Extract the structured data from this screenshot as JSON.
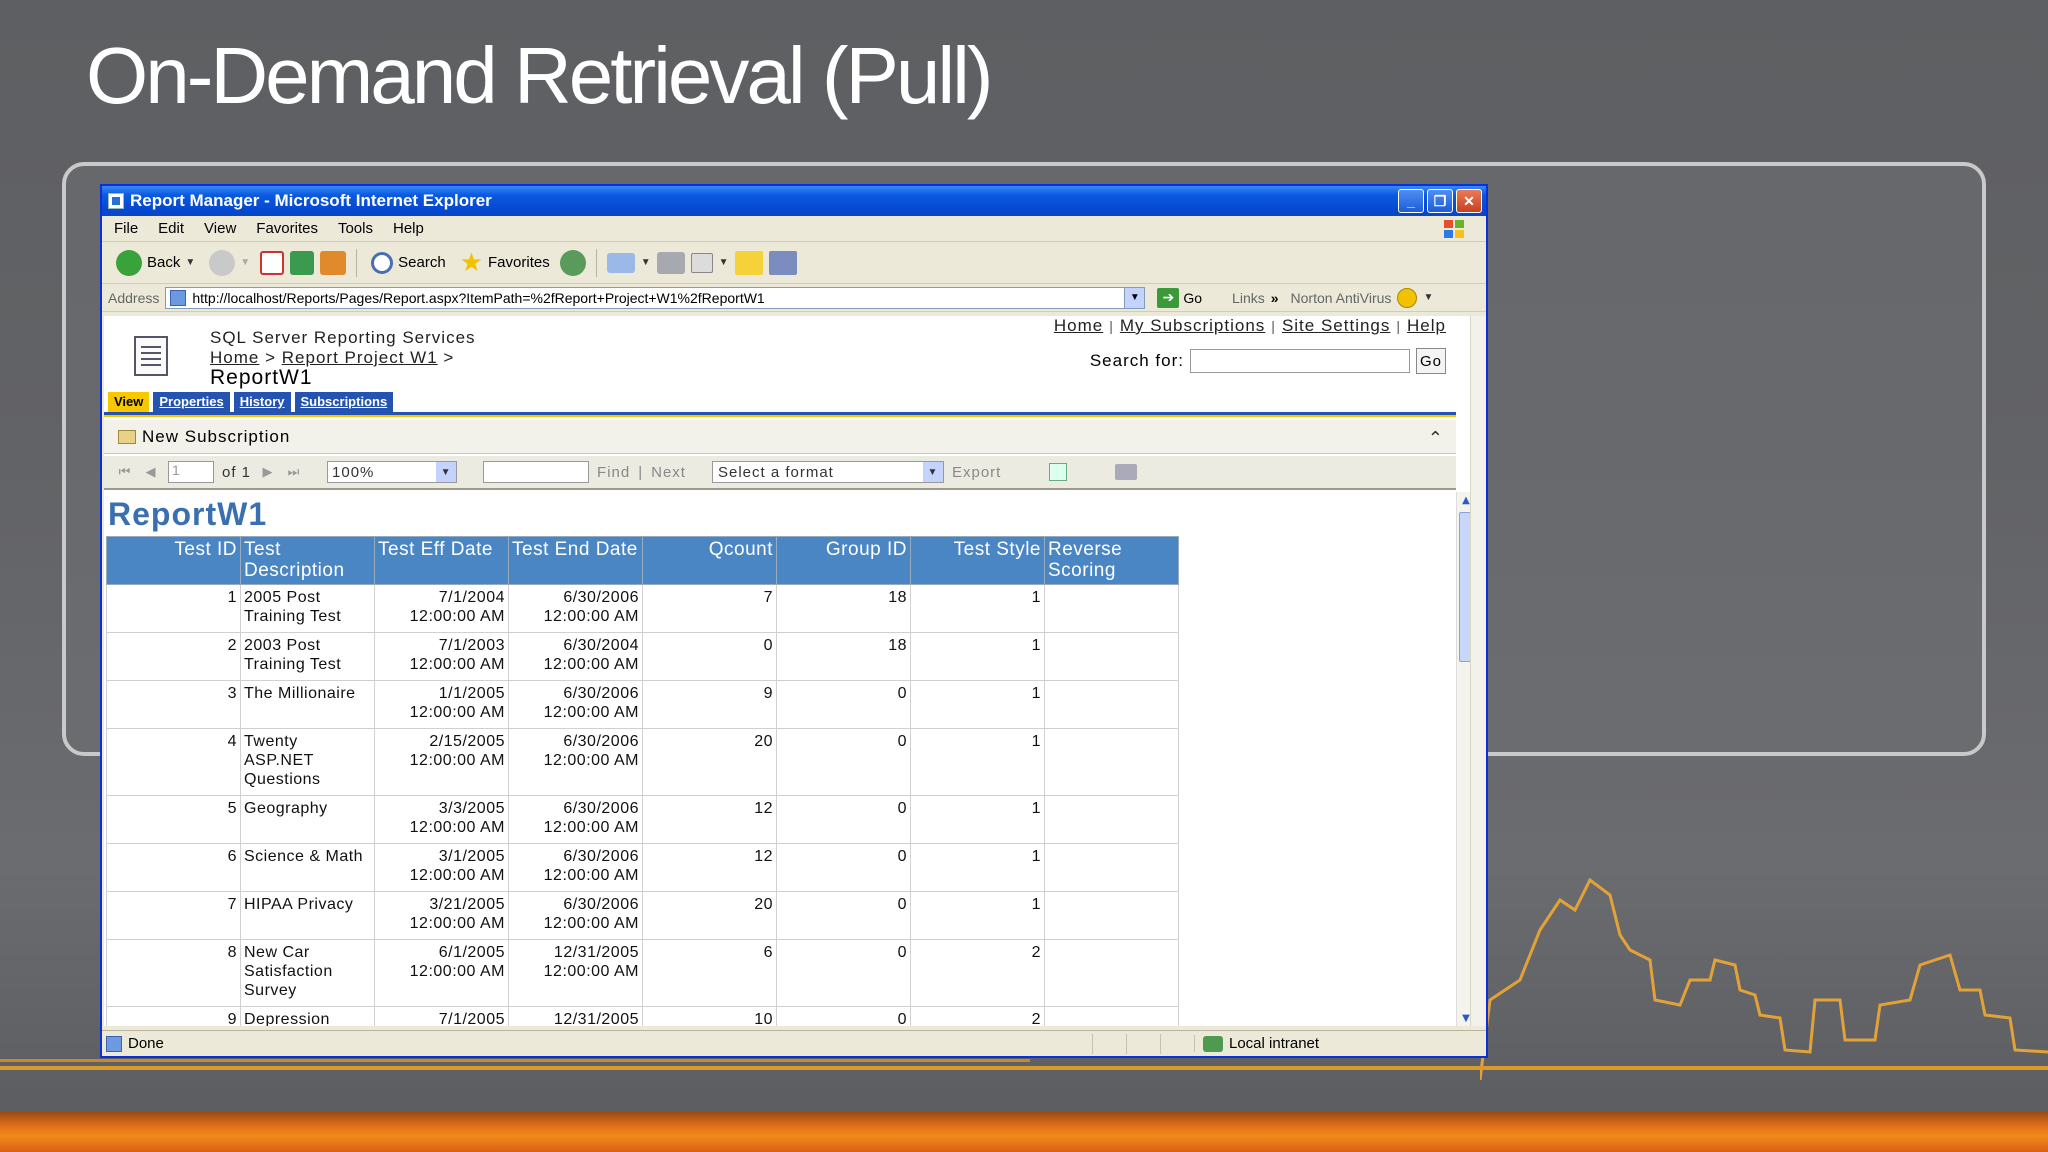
{
  "slide": {
    "title": "On-Demand Retrieval (Pull)"
  },
  "window": {
    "title": "Report Manager - Microsoft Internet Explorer"
  },
  "menu": [
    "File",
    "Edit",
    "View",
    "Favorites",
    "Tools",
    "Help"
  ],
  "toolbar": {
    "back": "Back",
    "search": "Search",
    "favorites": "Favorites"
  },
  "address": {
    "label": "Address",
    "url": "http://localhost/Reports/Pages/Report.aspx?ItemPath=%2fReport+Project+W1%2fReportW1",
    "go": "Go",
    "links": "Links",
    "links_more": "»",
    "norton": "Norton AntiVirus"
  },
  "rs": {
    "product": "SQL Server Reporting Services",
    "crumb_home": "Home",
    "crumb_project": "Report Project W1",
    "crumb_sep": ">",
    "report_name": "ReportW1",
    "links": {
      "home": "Home",
      "subs": "My Subscriptions",
      "site": "Site Settings",
      "help": "Help",
      "sep": "|"
    },
    "search_label": "Search for:",
    "search_go": "Go"
  },
  "tabs": [
    "View",
    "Properties",
    "History",
    "Subscriptions"
  ],
  "subscription": {
    "label": "New Subscription"
  },
  "report_toolbar": {
    "page": "1",
    "of": "of 1",
    "zoom": "100%",
    "find": "Find",
    "sep": "|",
    "next": "Next",
    "format": "Select a format",
    "export": "Export"
  },
  "report": {
    "heading": "ReportW1",
    "columns": [
      "Test ID",
      "Test Description",
      "Test Eff Date",
      "Test End Date",
      "Qcount",
      "Group ID",
      "Test Style",
      "Reverse Scoring"
    ],
    "rows": [
      {
        "id": "1",
        "desc": "2005 Post Training Test",
        "eff": "7/1/2004 12:00:00 AM",
        "end": "6/30/2006 12:00:00 AM",
        "q": "7",
        "g": "18",
        "s": "1",
        "r": ""
      },
      {
        "id": "2",
        "desc": "2003 Post Training Test",
        "eff": "7/1/2003 12:00:00 AM",
        "end": "6/30/2004 12:00:00 AM",
        "q": "0",
        "g": "18",
        "s": "1",
        "r": ""
      },
      {
        "id": "3",
        "desc": "The Millionaire",
        "eff": "1/1/2005 12:00:00 AM",
        "end": "6/30/2006 12:00:00 AM",
        "q": "9",
        "g": "0",
        "s": "1",
        "r": ""
      },
      {
        "id": "4",
        "desc": "Twenty ASP.NET Questions",
        "eff": "2/15/2005 12:00:00 AM",
        "end": "6/30/2006 12:00:00 AM",
        "q": "20",
        "g": "0",
        "s": "1",
        "r": ""
      },
      {
        "id": "5",
        "desc": "Geography",
        "eff": "3/3/2005 12:00:00 AM",
        "end": "6/30/2006 12:00:00 AM",
        "q": "12",
        "g": "0",
        "s": "1",
        "r": ""
      },
      {
        "id": "6",
        "desc": "Science & Math",
        "eff": "3/1/2005 12:00:00 AM",
        "end": "6/30/2006 12:00:00 AM",
        "q": "12",
        "g": "0",
        "s": "1",
        "r": ""
      },
      {
        "id": "7",
        "desc": "HIPAA Privacy",
        "eff": "3/21/2005 12:00:00 AM",
        "end": "6/30/2006 12:00:00 AM",
        "q": "20",
        "g": "0",
        "s": "1",
        "r": ""
      },
      {
        "id": "8",
        "desc": "New Car Satisfaction Survey",
        "eff": "6/1/2005 12:00:00 AM",
        "end": "12/31/2005 12:00:00 AM",
        "q": "6",
        "g": "0",
        "s": "2",
        "r": ""
      },
      {
        "id": "9",
        "desc": "Depression",
        "eff": "7/1/2005",
        "end": "12/31/2005",
        "q": "10",
        "g": "0",
        "s": "2",
        "r": ""
      }
    ]
  },
  "status": {
    "done": "Done",
    "zone": "Local intranet"
  },
  "colors": {
    "header_blue": "#4a86c4",
    "tab_yellow": "#f7c800",
    "slide_bg": "#626366",
    "accent_orange": "#f28a1c"
  }
}
